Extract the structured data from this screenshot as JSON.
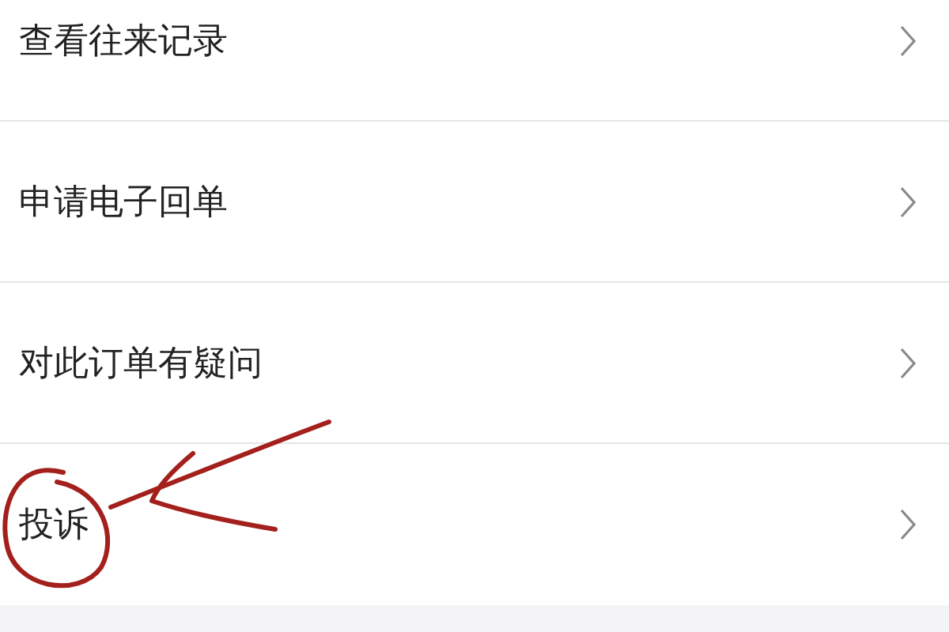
{
  "menu": [
    {
      "label": "查看往来记录",
      "annotated": false
    },
    {
      "label": "申请电子回单",
      "annotated": false
    },
    {
      "label": "对此订单有疑问",
      "annotated": false
    },
    {
      "label": "投诉",
      "annotated": true
    }
  ]
}
